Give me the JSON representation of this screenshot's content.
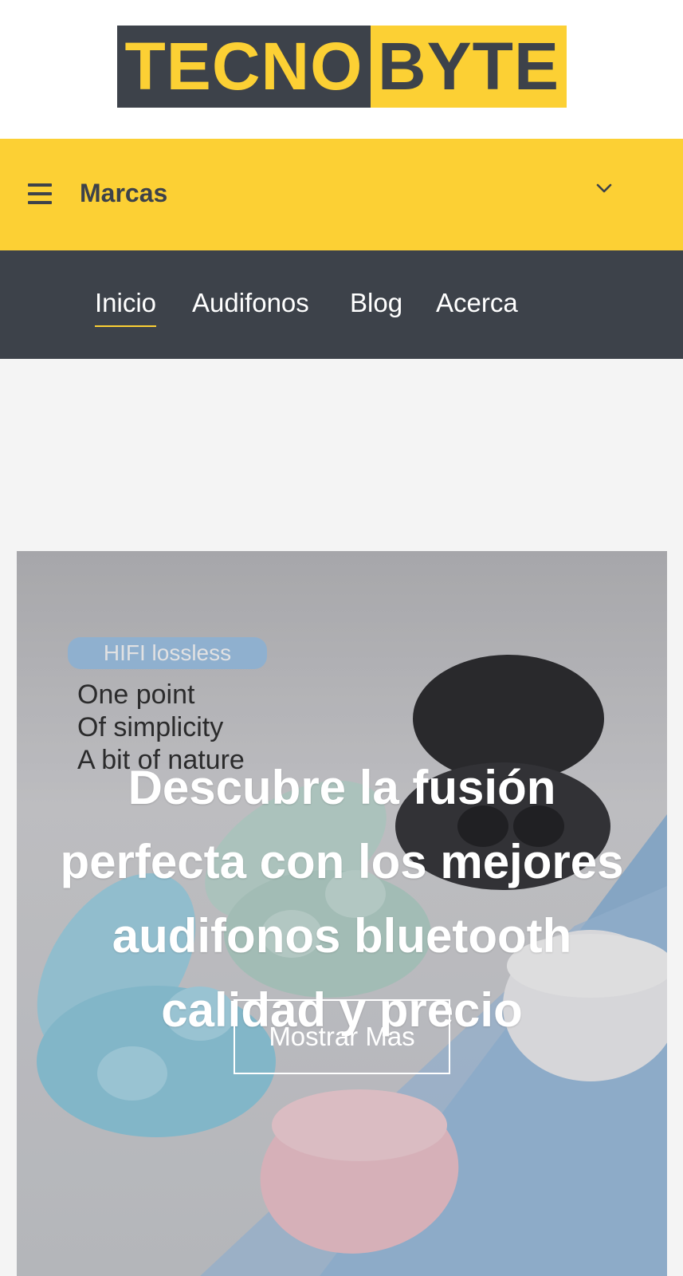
{
  "logo": {
    "part1": "TECNO",
    "part2": "BYTE"
  },
  "brands_bar": {
    "label": "Marcas",
    "menu_icon": "hamburger-menu-icon",
    "dropdown_icon": "chevron-down-icon"
  },
  "nav": {
    "items": [
      {
        "label": "Inicio",
        "active": true
      },
      {
        "label": "Audifonos"
      },
      {
        "label": "Blog"
      },
      {
        "label": "Acerca"
      }
    ]
  },
  "hero": {
    "image_text": {
      "badge": "HIFI lossless",
      "line1": "One point",
      "line2": "Of simplicity",
      "line3": "A bit of nature"
    },
    "title": "Descubre la fusión perfecta con los mejores audifonos bluetooth calidad y precio",
    "button_label": "Mostrar Mas"
  },
  "colors": {
    "yellow": "#fcd034",
    "dark": "#3d424a",
    "white": "#ffffff",
    "background": "#f4f4f4"
  }
}
